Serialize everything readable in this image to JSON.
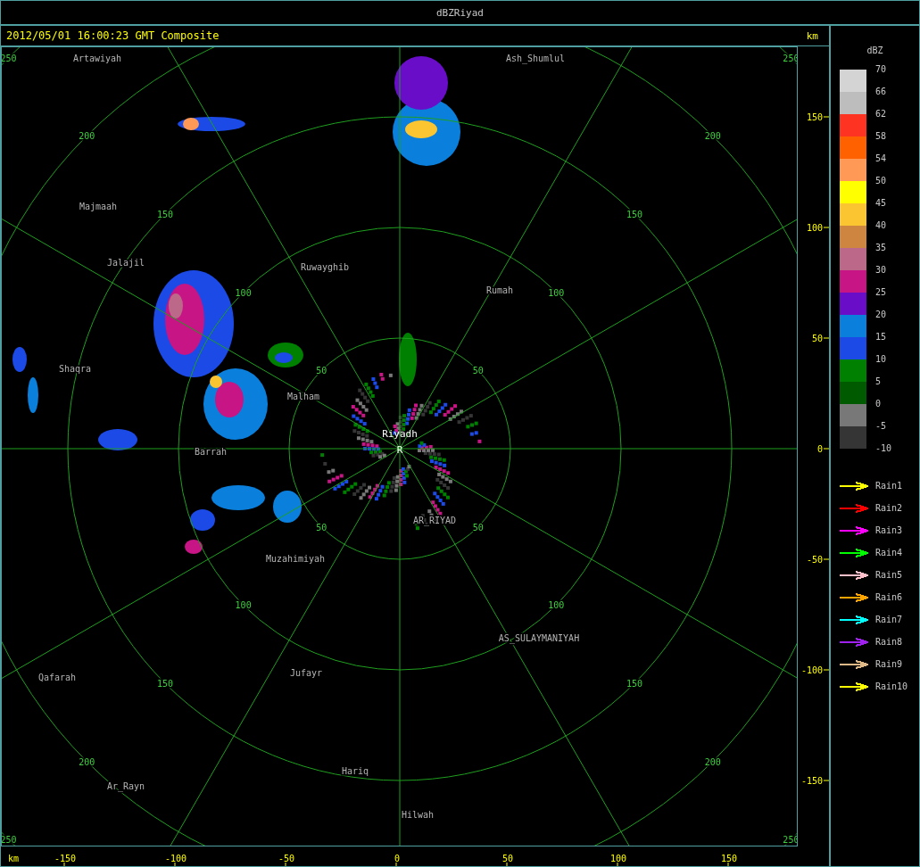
{
  "window": {
    "title": "dBZRiyad"
  },
  "header": {
    "timestamp": "2012/05/01 16:00:23 GMT Composite",
    "unit": "km"
  },
  "map": {
    "rings": [
      {
        "labels": [
          "50",
          "50",
          "50",
          "50"
        ]
      },
      {
        "labels": [
          "100",
          "100",
          "100",
          "100"
        ]
      },
      {
        "labels": [
          "150",
          "150",
          "150",
          "150"
        ]
      },
      {
        "labels": [
          "200",
          "200",
          "200",
          "200"
        ]
      },
      {
        "labels": [
          "250",
          "250",
          "250",
          "250"
        ]
      }
    ],
    "places": [
      {
        "name": "Artawiyah"
      },
      {
        "name": "Ash_Shumlul"
      },
      {
        "name": "Majmaah"
      },
      {
        "name": "Jalajil"
      },
      {
        "name": "Ruwayghib"
      },
      {
        "name": "Rumah"
      },
      {
        "name": "Shaqra"
      },
      {
        "name": "Malham"
      },
      {
        "name": "Barrah"
      },
      {
        "name": "AR_RIYAD"
      },
      {
        "name": "Muzahimiyah"
      },
      {
        "name": "AS_SULAYMANIYAH"
      },
      {
        "name": "Qafarah"
      },
      {
        "name": "Jufayr"
      },
      {
        "name": "Hariq"
      },
      {
        "name": "Ar_Rayn"
      },
      {
        "name": "Hilwah"
      }
    ],
    "site": {
      "name": "Riyadh",
      "marker": "R"
    }
  },
  "y_axis": {
    "ticks": [
      "150",
      "100",
      "50",
      "0",
      "-50",
      "-100",
      "-150"
    ]
  },
  "x_axis": {
    "unit": "km",
    "ticks": [
      "-150",
      "-100",
      "-50",
      "0",
      "50",
      "100",
      "150"
    ]
  },
  "legend": {
    "title": "dBZ",
    "bands": [
      {
        "label": "70",
        "color": "#d4d4d4"
      },
      {
        "label": "66",
        "color": "#bdbdbd"
      },
      {
        "label": "62",
        "color": "#ff3322"
      },
      {
        "label": "58",
        "color": "#ff6000"
      },
      {
        "label": "54",
        "color": "#ff9955"
      },
      {
        "label": "50",
        "color": "#ffff00"
      },
      {
        "label": "45",
        "color": "#fbc531"
      },
      {
        "label": "40",
        "color": "#cd853f"
      },
      {
        "label": "35",
        "color": "#bc6888"
      },
      {
        "label": "30",
        "color": "#c71585"
      },
      {
        "label": "25",
        "color": "#6a0dc9"
      },
      {
        "label": "20",
        "color": "#0a80dc"
      },
      {
        "label": "15",
        "color": "#1c4ae6"
      },
      {
        "label": "10",
        "color": "#008000"
      },
      {
        "label": "5",
        "color": "#005a00"
      },
      {
        "label": "0",
        "color": "#787878"
      },
      {
        "label": "-5",
        "color": "#353535"
      }
    ],
    "bottom_label": "-10",
    "tracks": [
      {
        "name": "Rain1",
        "color": "#ffff00"
      },
      {
        "name": "Rain2",
        "color": "#ff0000"
      },
      {
        "name": "Rain3",
        "color": "#ff00ff"
      },
      {
        "name": "Rain4",
        "color": "#00ff00"
      },
      {
        "name": "Rain5",
        "color": "#ffc0cb"
      },
      {
        "name": "Rain6",
        "color": "#ffa500"
      },
      {
        "name": "Rain7",
        "color": "#00ffff"
      },
      {
        "name": "Rain8",
        "color": "#a020f0"
      },
      {
        "name": "Rain9",
        "color": "#deb887"
      },
      {
        "name": "Rain10",
        "color": "#ffff00"
      }
    ]
  }
}
